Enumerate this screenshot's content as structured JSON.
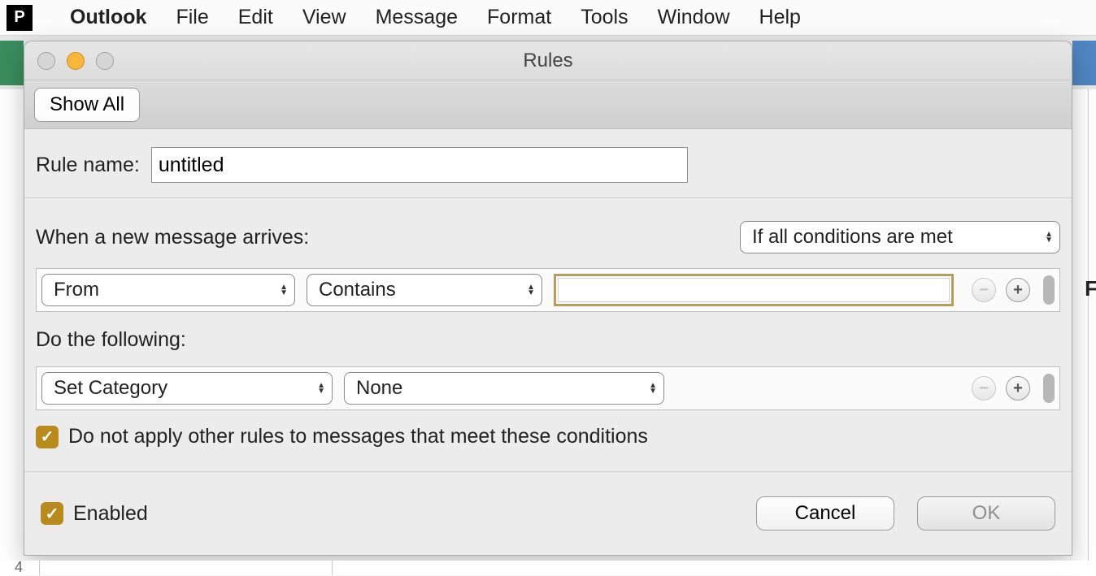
{
  "menubar": {
    "app": "Outlook",
    "items": [
      "File",
      "Edit",
      "View",
      "Message",
      "Format",
      "Tools",
      "Window",
      "Help"
    ]
  },
  "dialog": {
    "title": "Rules",
    "show_all": "Show All",
    "rule_name_label": "Rule name:",
    "rule_name_value": "untitled",
    "when_label": "When a new message arrives:",
    "match_mode": "If all conditions are met",
    "condition": {
      "field": "From",
      "op": "Contains",
      "value": ""
    },
    "do_label": "Do the following:",
    "action": {
      "type": "Set Category",
      "value": "None"
    },
    "stop_rules_label": "Do not apply other rules to messages that meet these conditions",
    "enabled_label": "Enabled",
    "cancel": "Cancel",
    "ok": "OK"
  },
  "icons": {
    "p": "P",
    "apple": "",
    "check": "✓",
    "minus": "−",
    "plus": "+",
    "up": "▲",
    "down": "▼"
  },
  "below_row": "4",
  "right_letter": "F"
}
